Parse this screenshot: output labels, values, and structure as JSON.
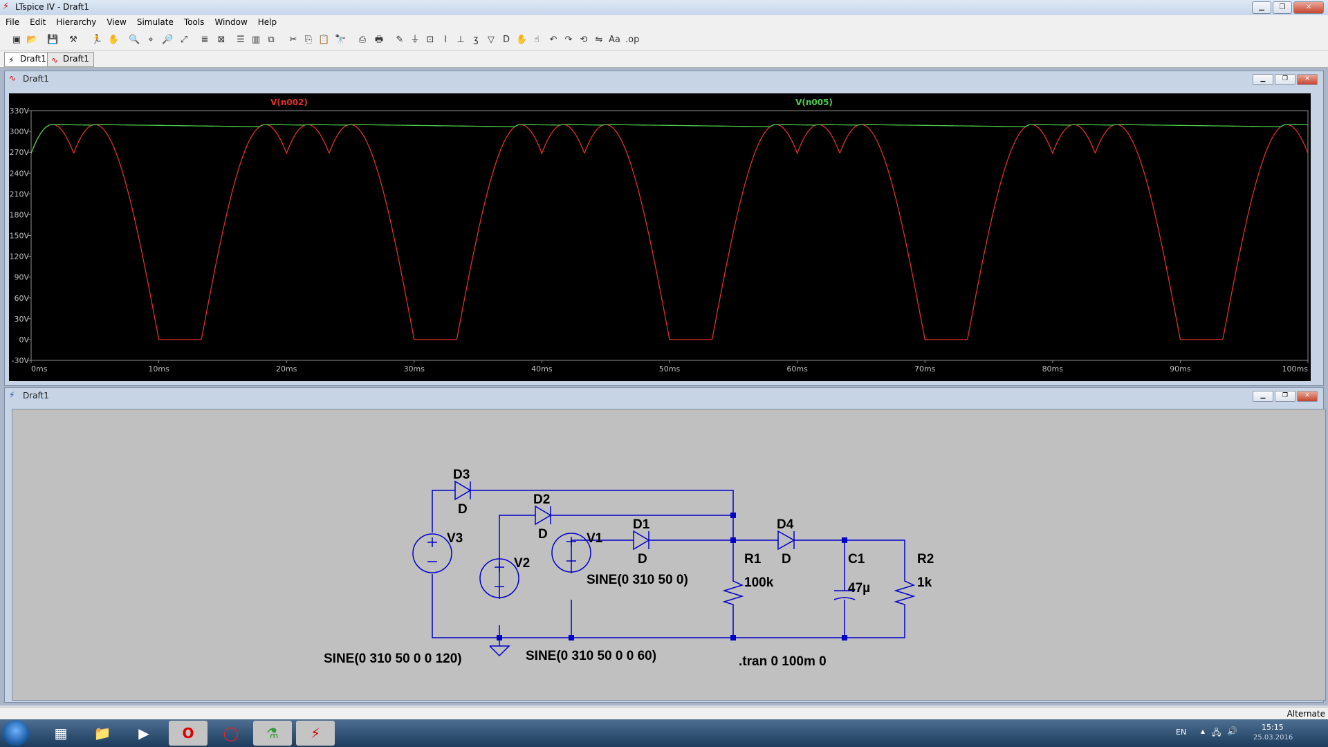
{
  "window": {
    "title": "LTspice IV - Draft1",
    "app_icon": "ltspice-icon"
  },
  "menu": [
    "File",
    "Edit",
    "Hierarchy",
    "View",
    "Simulate",
    "Tools",
    "Window",
    "Help"
  ],
  "tabs": [
    {
      "label": "Draft1",
      "icon": "schematic-icon"
    },
    {
      "label": "Draft1",
      "icon": "waveform-icon"
    }
  ],
  "plot_window": {
    "title": "Draft1"
  },
  "schematic_window": {
    "title": "Draft1"
  },
  "chart_data": {
    "type": "line",
    "ylim": [
      -30,
      330
    ],
    "xlim": [
      0,
      100
    ],
    "yticks": [
      "330V",
      "300V",
      "270V",
      "240V",
      "210V",
      "180V",
      "150V",
      "120V",
      "90V",
      "60V",
      "30V",
      "0V",
      "-30V"
    ],
    "ytick_values": [
      330,
      300,
      270,
      240,
      210,
      180,
      150,
      120,
      90,
      60,
      30,
      0,
      -30
    ],
    "xticks": [
      "0ms",
      "10ms",
      "20ms",
      "30ms",
      "40ms",
      "50ms",
      "60ms",
      "70ms",
      "80ms",
      "90ms",
      "100ms"
    ],
    "xtick_values": [
      0,
      10,
      20,
      30,
      40,
      50,
      60,
      70,
      80,
      90,
      100
    ],
    "grid": false,
    "series": [
      {
        "name": "V(n002)",
        "color": "#e03030"
      },
      {
        "name": "V(n005)",
        "color": "#4ccf4c"
      }
    ],
    "source": {
      "amplitude": 310,
      "frequency_hz": 50,
      "phases_deg": [
        0,
        60,
        120
      ]
    },
    "load_decay": 0.2
  },
  "schematic": {
    "components": [
      {
        "ref": "D3",
        "value": "D"
      },
      {
        "ref": "D2",
        "value": "D"
      },
      {
        "ref": "D1",
        "value": "D"
      },
      {
        "ref": "D4",
        "value": "D"
      },
      {
        "ref": "V3",
        "value": "SINE(0 310 50 0 0 120)"
      },
      {
        "ref": "V2",
        "value": "SINE(0 310 50 0 0 60)"
      },
      {
        "ref": "V1",
        "value": "SINE(0 310 50 0)"
      },
      {
        "ref": "R1",
        "value": "100k"
      },
      {
        "ref": "C1",
        "value": "47µ"
      },
      {
        "ref": "R2",
        "value": "1k"
      }
    ],
    "directive": ".tran 0 100m 0"
  },
  "status": {
    "mode": "Alternate"
  },
  "tray": {
    "lang": "EN",
    "time": "15:15",
    "date": "25.03.2016"
  }
}
